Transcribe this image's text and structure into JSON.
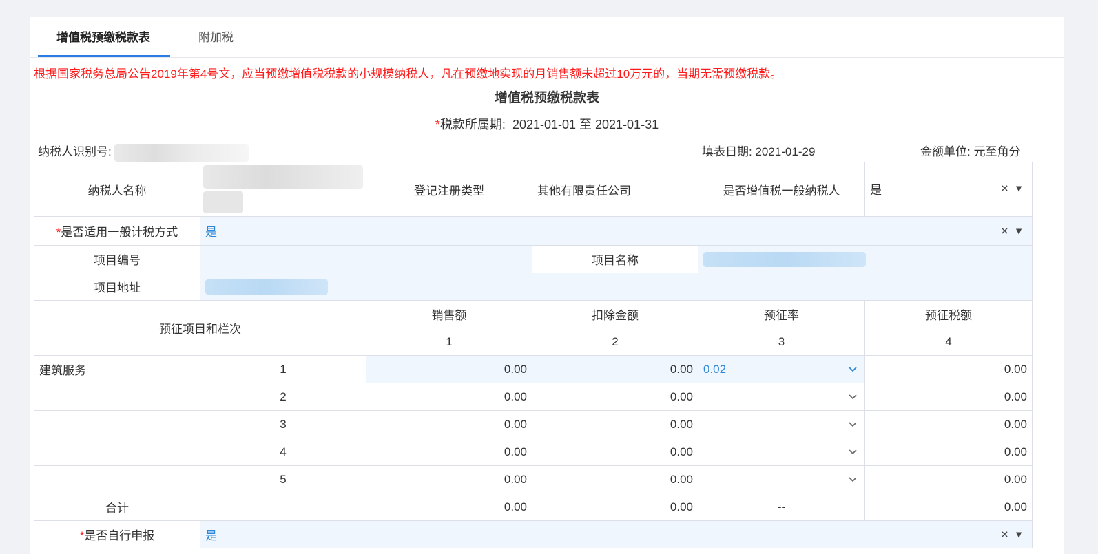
{
  "tabs": [
    {
      "label": "增值税预缴税款表",
      "active": true
    },
    {
      "label": "附加税",
      "active": false
    }
  ],
  "notice": "根据国家税务总局公告2019年第4号文，应当预缴增值税税款的小规模纳税人，凡在预缴地实现的月销售额未超过10万元的，当期无需预缴税款。",
  "form": {
    "title": "增值税预缴税款表",
    "period_label": "税款所属期:",
    "period_value": "2021-01-01 至 2021-01-31",
    "taxpayer_id_label": "纳税人识别号:",
    "fill_date": "填表日期: 2021-01-29",
    "amount_unit": "金额单位: 元至角分",
    "taxpayer_name_label": "纳税人名称",
    "reg_type_label": "登记注册类型",
    "reg_type_value": "其他有限责任公司",
    "general_taxpayer_label": "是否增值税一般纳税人",
    "general_taxpayer_value": "是",
    "general_method_label": "是否适用一般计税方式",
    "general_method_value": "是",
    "project_no_label": "项目编号",
    "project_name_label": "项目名称",
    "project_addr_label": "项目地址",
    "col_header": "预征项目和栏次",
    "columns": [
      "销售额",
      "扣除金额",
      "预征率",
      "预征税额"
    ],
    "column_nums": [
      "1",
      "2",
      "3",
      "4"
    ],
    "rows": [
      {
        "name": "建筑服务",
        "num": "1",
        "sales": "0.00",
        "deduct": "0.00",
        "rate": "0.02",
        "tax": "0.00"
      },
      {
        "name": "",
        "num": "2",
        "sales": "0.00",
        "deduct": "0.00",
        "rate": "",
        "tax": "0.00"
      },
      {
        "name": "",
        "num": "3",
        "sales": "0.00",
        "deduct": "0.00",
        "rate": "",
        "tax": "0.00"
      },
      {
        "name": "",
        "num": "4",
        "sales": "0.00",
        "deduct": "0.00",
        "rate": "",
        "tax": "0.00"
      },
      {
        "name": "",
        "num": "5",
        "sales": "0.00",
        "deduct": "0.00",
        "rate": "",
        "tax": "0.00"
      }
    ],
    "total": {
      "label": "合计",
      "sales": "0.00",
      "deduct": "0.00",
      "rate": "--",
      "tax": "0.00"
    },
    "self_report_label": "是否自行申报",
    "self_report_value": "是"
  },
  "icons": {
    "clear": "close-icon",
    "dropdown": "caret-down-icon",
    "chevron": "chevron-down-icon"
  },
  "colors": {
    "accent": "#2d7be5",
    "notice": "#ff1a1a",
    "input_bg": "#f0f6fd",
    "value_blue": "#2d87d8"
  }
}
